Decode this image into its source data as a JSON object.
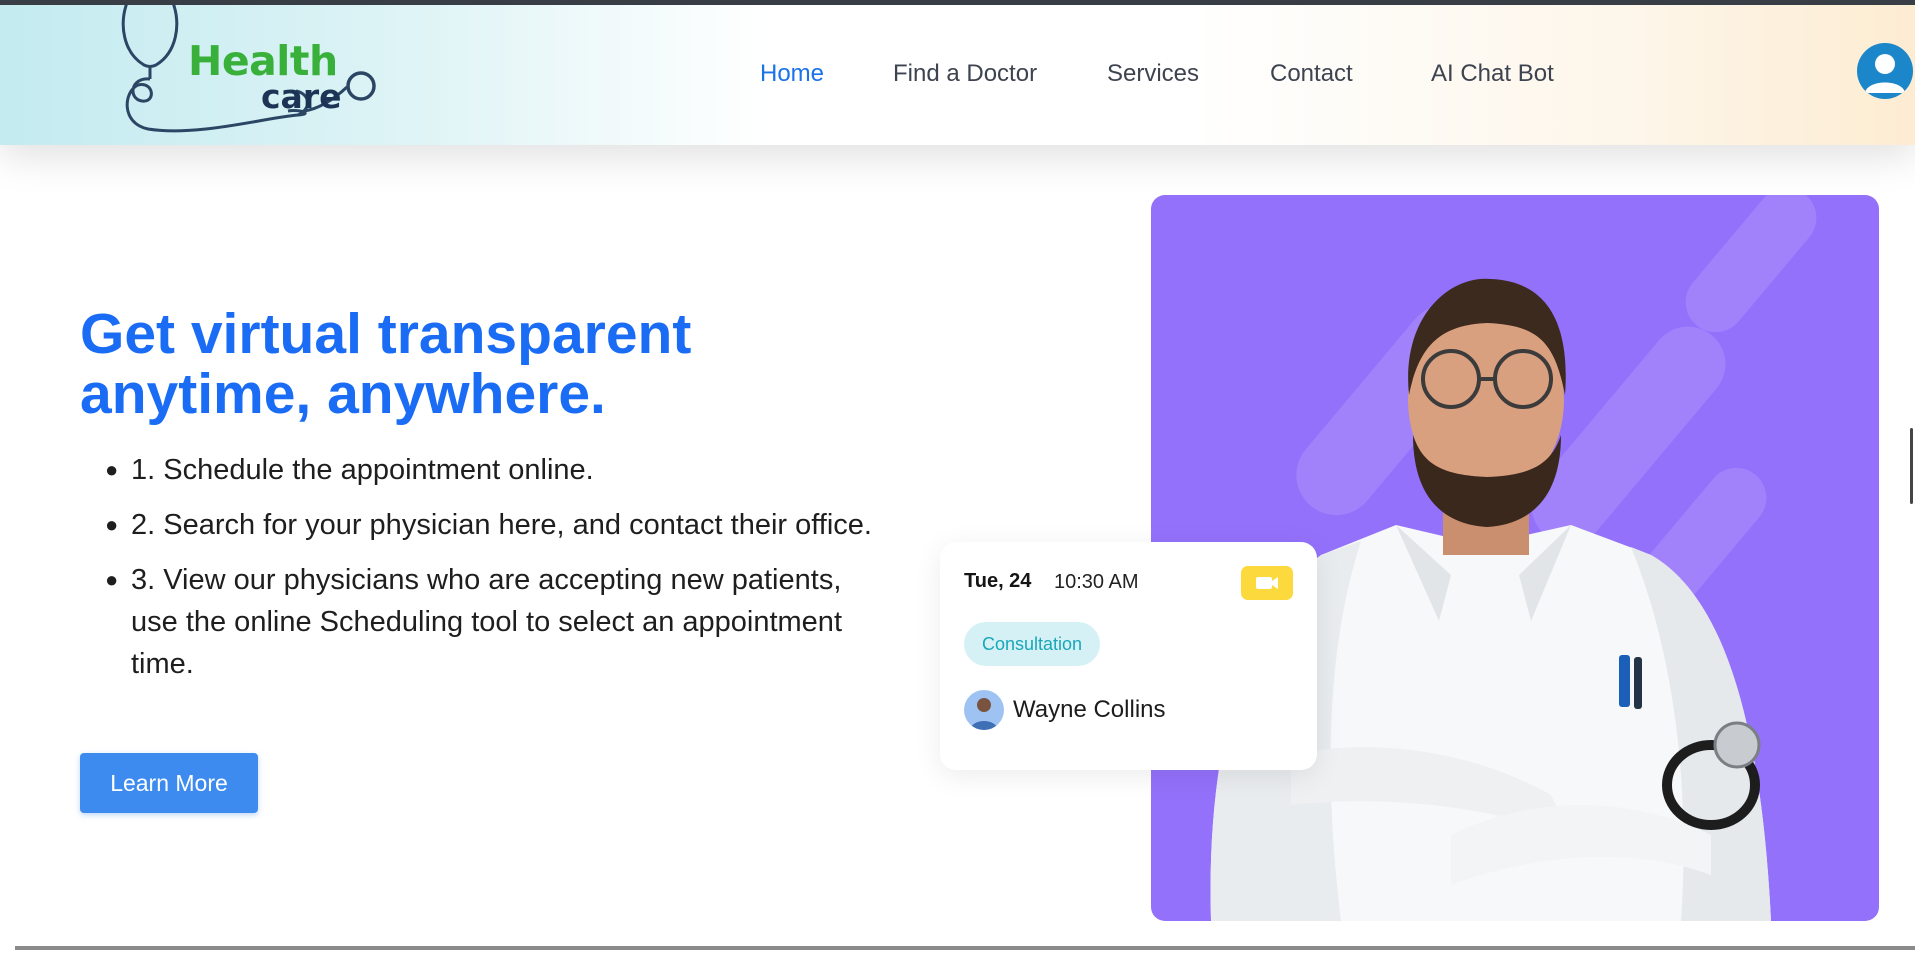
{
  "header": {
    "logo": {
      "word1": "Health",
      "word2": "care"
    },
    "nav": [
      {
        "label": "Home",
        "active": true
      },
      {
        "label": "Find a Doctor",
        "active": false
      },
      {
        "label": "Services",
        "active": false
      },
      {
        "label": "Contact",
        "active": false
      },
      {
        "label": "AI Chat Bot",
        "active": false
      }
    ],
    "profile_icon": "user-icon"
  },
  "hero": {
    "title_line1": "Get virtual transparent",
    "title_line2": "anytime, anywhere.",
    "steps": [
      "1. Schedule the appointment online.",
      "2. Search for your physician here, and contact their office.",
      "3. View our physicians who are accepting new patients, use the online Scheduling tool to select an appointment time."
    ],
    "cta_label": "Learn More"
  },
  "appointment_card": {
    "day": "Tue, 24",
    "time": "10:30 AM",
    "type": "Consultation",
    "doctor_name": "Wayne Collins",
    "video_icon": "video-camera-icon"
  },
  "colors": {
    "accent": "#1a6cf5",
    "button": "#3e8bef",
    "promo_background": "#9471fb",
    "video_badge": "#fcd93c",
    "logo_green": "#39b03a",
    "logo_navy": "#1c3556"
  }
}
